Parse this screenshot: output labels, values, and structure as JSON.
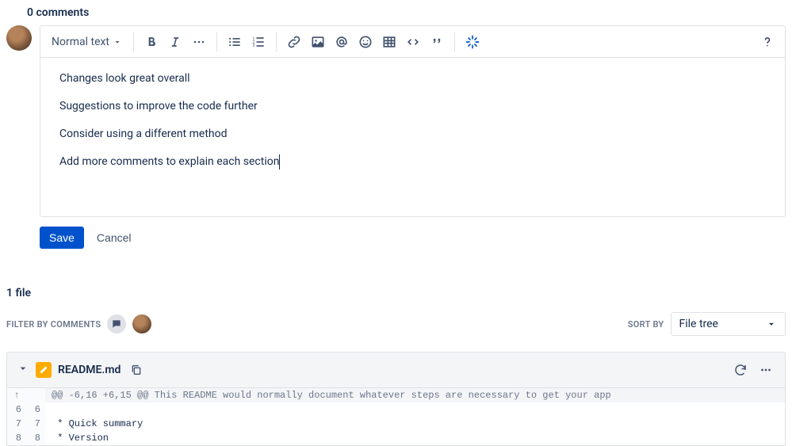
{
  "comments_header": "0 comments",
  "toolbar": {
    "text_style": "Normal text"
  },
  "editor": {
    "lines": [
      "Changes look great overall",
      "Suggestions to improve the code further",
      "Consider using a different method",
      "Add more comments to explain each section"
    ]
  },
  "actions": {
    "save": "Save",
    "cancel": "Cancel"
  },
  "file_count": "1 file",
  "filters": {
    "label": "FILTER BY COMMENTS"
  },
  "sort": {
    "label": "SORT BY",
    "value": "File tree"
  },
  "file": {
    "name": "README.md"
  },
  "diff": {
    "hunk": "@@ -6,16 +6,15 @@ This README would normally document whatever steps are necessary to get your app",
    "rows": [
      {
        "old": "6",
        "new": "6",
        "text": ""
      },
      {
        "old": "7",
        "new": "7",
        "text": " * Quick summary"
      },
      {
        "old": "8",
        "new": "8",
        "text": " * Version"
      }
    ]
  }
}
